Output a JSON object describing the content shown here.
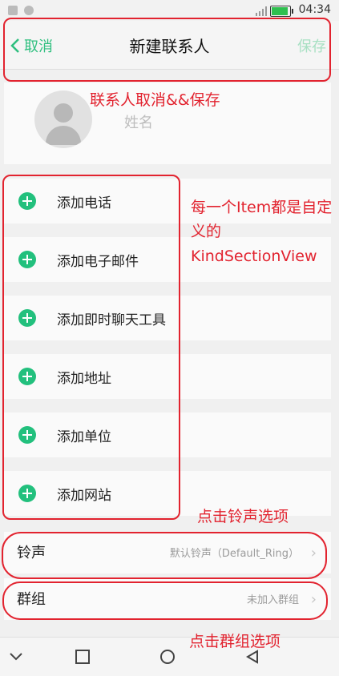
{
  "status_bar": {
    "time": "04:34"
  },
  "header": {
    "cancel_label": "取消",
    "title": "新建联系人",
    "save_label": "保存"
  },
  "name_card": {
    "name_placeholder": "姓名"
  },
  "kind_sections": [
    {
      "label": "添加电话"
    },
    {
      "label": "添加电子邮件"
    },
    {
      "label": "添加即时聊天工具"
    },
    {
      "label": "添加地址"
    },
    {
      "label": "添加单位"
    },
    {
      "label": "添加网站"
    }
  ],
  "settings": {
    "ringtone": {
      "label": "铃声",
      "value": "默认铃声（Default_Ring）"
    },
    "group": {
      "label": "群组",
      "value": "未加入群组"
    }
  },
  "annotations": {
    "header_note": "联系人取消&&保存",
    "item_note": "每一个Item都是自定义的KindSectionView",
    "ringtone_note": "点击铃声选项",
    "group_note": "点击群组选项"
  },
  "colors": {
    "accent": "#22c07d",
    "annotation": "#e2232f"
  }
}
